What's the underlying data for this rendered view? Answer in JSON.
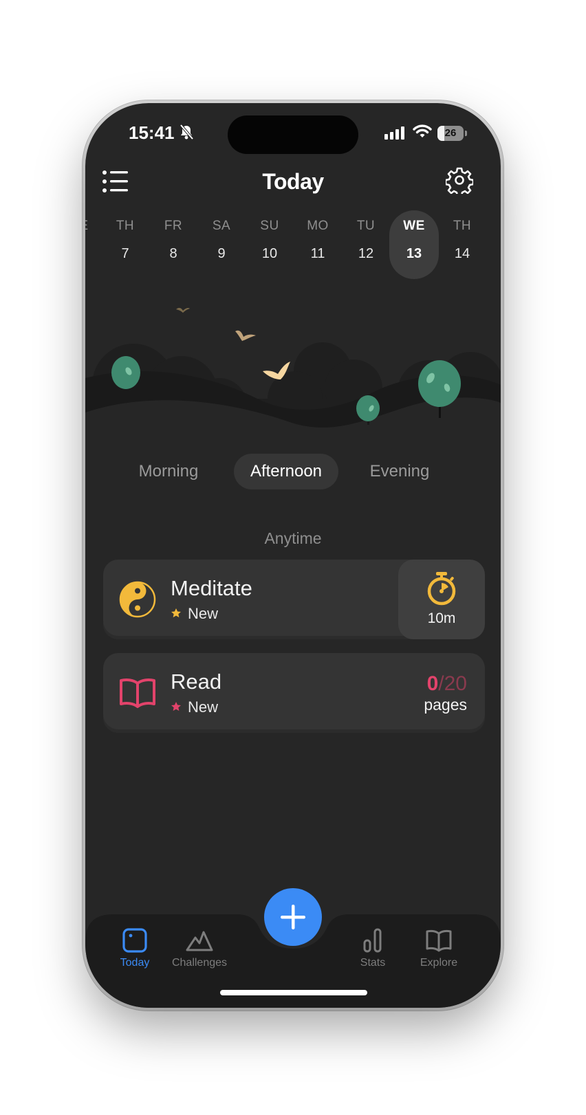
{
  "status_bar": {
    "time": "15:41",
    "battery": "26",
    "battery_level": 0.26
  },
  "header": {
    "title": "Today"
  },
  "calendar": {
    "partial_left": "E",
    "days": [
      {
        "dow": "TH",
        "num": "7"
      },
      {
        "dow": "FR",
        "num": "8"
      },
      {
        "dow": "SA",
        "num": "9"
      },
      {
        "dow": "SU",
        "num": "10"
      },
      {
        "dow": "MO",
        "num": "11"
      },
      {
        "dow": "TU",
        "num": "12"
      },
      {
        "dow": "WE",
        "num": "13",
        "selected": true
      },
      {
        "dow": "TH",
        "num": "14"
      }
    ]
  },
  "periods": [
    {
      "label": "Morning"
    },
    {
      "label": "Afternoon",
      "active": true
    },
    {
      "label": "Evening"
    }
  ],
  "section": {
    "label": "Anytime"
  },
  "habits": [
    {
      "name": "Meditate",
      "badge": "New",
      "icon": "yin-yang-icon",
      "color": "#f2b93b",
      "timer_label": "10m"
    },
    {
      "name": "Read",
      "badge": "New",
      "icon": "open-book-icon",
      "color": "#e2436b",
      "done": "0",
      "separator": "/",
      "target": "20",
      "unit": "pages"
    }
  ],
  "tabs": [
    {
      "label": "Today",
      "icon": "today-icon",
      "active": true
    },
    {
      "label": "Challenges",
      "icon": "mountain-icon"
    },
    {
      "label": "Stats",
      "icon": "bar-chart-icon"
    },
    {
      "label": "Explore",
      "icon": "book-icon"
    }
  ],
  "colors": {
    "accent": "#3b8bf5",
    "background": "#262626",
    "card": "#343434"
  }
}
